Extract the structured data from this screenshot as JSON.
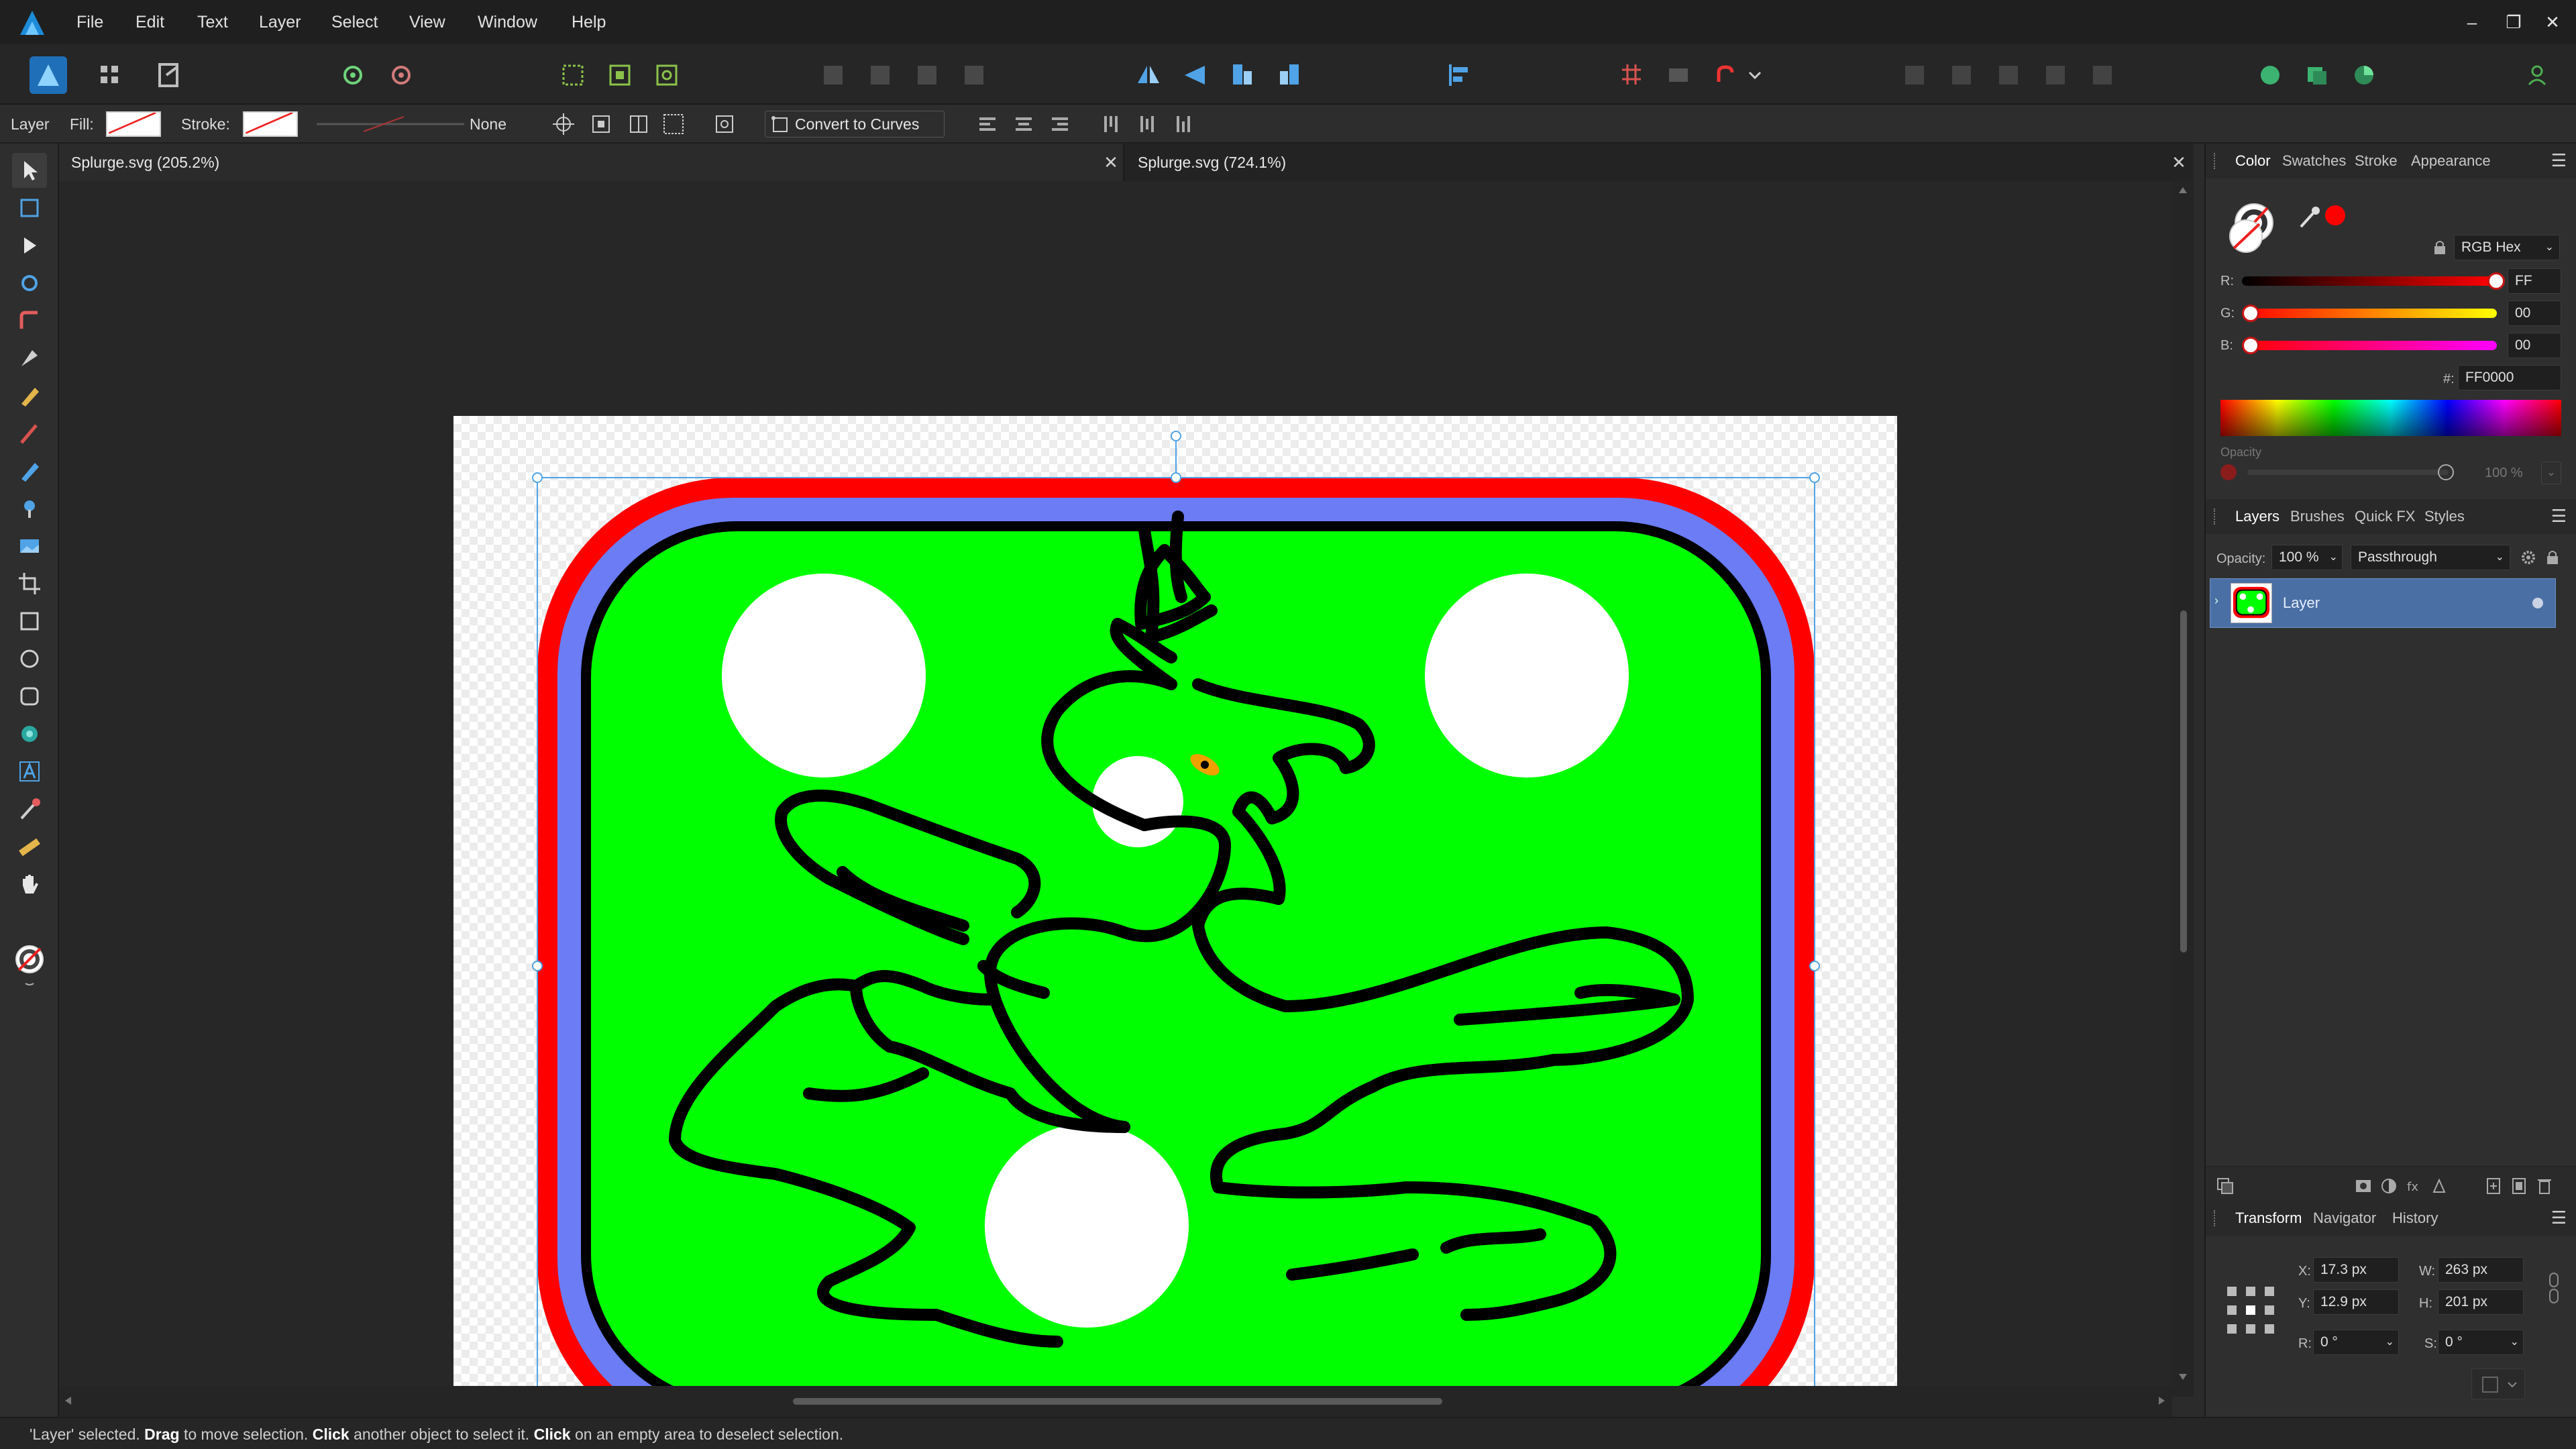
{
  "app": {
    "name": "Affinity Designer"
  },
  "menu": {
    "items": [
      "File",
      "Edit",
      "Text",
      "Layer",
      "Select",
      "View",
      "Window",
      "Help"
    ]
  },
  "window_controls": {
    "minimize": "–",
    "restore": "❐",
    "close": "✕"
  },
  "context": {
    "selection_label": "Layer",
    "fill_label": "Fill:",
    "stroke_label": "Stroke:",
    "stroke_width": "None",
    "convert_label": "Convert to Curves"
  },
  "document_tabs": [
    {
      "title": "Splurge.svg (205.2%)",
      "close": "✕"
    },
    {
      "title": "Splurge.svg (724.1%)",
      "close": "✕"
    }
  ],
  "color_panel": {
    "tabs": [
      "Color",
      "Swatches",
      "Stroke",
      "Appearance"
    ],
    "mode": "RGB Hex",
    "r_label": "R:",
    "g_label": "G:",
    "b_label": "B:",
    "r_value": "FF",
    "g_value": "00",
    "b_value": "00",
    "hex_label": "#:",
    "hex_value": "FF0000",
    "opacity_label": "Opacity",
    "opacity_value": "100 %",
    "colors": {
      "current": "#ff0000"
    }
  },
  "layers_panel": {
    "tabs": [
      "Layers",
      "Brushes",
      "Quick FX",
      "Styles"
    ],
    "opacity_label": "Opacity:",
    "opacity_value": "100 %",
    "blend_mode": "Passthrough",
    "layers": [
      {
        "name": "Layer",
        "selected": true
      }
    ]
  },
  "transform_panel": {
    "tabs": [
      "Transform",
      "Navigator",
      "History"
    ],
    "x_label": "X:",
    "x_value": "17.3 px",
    "y_label": "Y:",
    "y_value": "12.9 px",
    "w_label": "W:",
    "w_value": "263 px",
    "h_label": "H:",
    "h_value": "201 px",
    "r_label": "R:",
    "r_value": "0 °",
    "s_label": "S:",
    "s_value": "0 °"
  },
  "status": {
    "part1": "'Layer' selected. ",
    "b1": "Drag",
    "part2": " to move selection. ",
    "b2": "Click",
    "part3": " another object to select it. ",
    "b3": "Click",
    "part4": " on an empty area to deselect selection."
  },
  "artwork_colors": {
    "outer_border": "#ff0000",
    "middle_border": "#6b7cf5",
    "inner_border": "#000000",
    "fill": "#00ff00",
    "dots": "#ffffff",
    "eye": "#f0a000"
  }
}
